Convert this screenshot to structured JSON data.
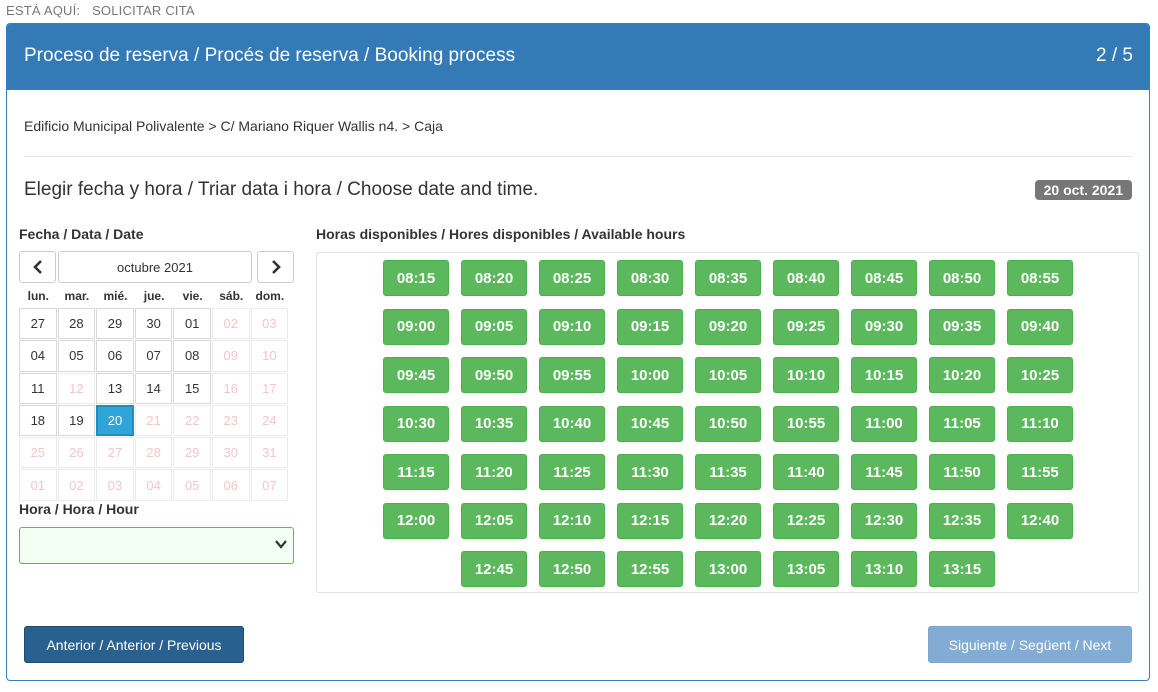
{
  "breadcrumb": {
    "label": "ESTÁ AQUÍ:",
    "current": "SOLICITAR CITA"
  },
  "panel": {
    "title": "Proceso de reserva / Procés de reserva / Booking process",
    "step": "2 / 5"
  },
  "location": "Edificio Municipal Polivalente > C/ Mariano Riquer Wallis n4. > Caja",
  "section_title": "Elegir fecha y hora / Triar data i hora / Choose date and time.",
  "selected_date_badge": "20 oct. 2021",
  "labels": {
    "date": "Fecha / Data / Date",
    "hours": "Horas disponibles / Hores disponibles / Available hours",
    "hour": "Hora / Hora / Hour"
  },
  "calendar": {
    "month": "octubre 2021",
    "prev_icon": "chevron-left-icon",
    "next_icon": "chevron-right-icon",
    "weekdays": [
      "lun.",
      "mar.",
      "mié.",
      "jue.",
      "vie.",
      "sáb.",
      "dom."
    ],
    "days": [
      {
        "d": "27",
        "s": "on"
      },
      {
        "d": "28",
        "s": "on"
      },
      {
        "d": "29",
        "s": "on"
      },
      {
        "d": "30",
        "s": "on"
      },
      {
        "d": "01",
        "s": "on"
      },
      {
        "d": "02",
        "s": "off"
      },
      {
        "d": "03",
        "s": "off"
      },
      {
        "d": "04",
        "s": "on"
      },
      {
        "d": "05",
        "s": "on"
      },
      {
        "d": "06",
        "s": "on"
      },
      {
        "d": "07",
        "s": "on"
      },
      {
        "d": "08",
        "s": "on"
      },
      {
        "d": "09",
        "s": "off"
      },
      {
        "d": "10",
        "s": "off"
      },
      {
        "d": "11",
        "s": "on"
      },
      {
        "d": "12",
        "s": "off"
      },
      {
        "d": "13",
        "s": "on"
      },
      {
        "d": "14",
        "s": "on"
      },
      {
        "d": "15",
        "s": "on"
      },
      {
        "d": "16",
        "s": "off"
      },
      {
        "d": "17",
        "s": "off"
      },
      {
        "d": "18",
        "s": "on"
      },
      {
        "d": "19",
        "s": "on"
      },
      {
        "d": "20",
        "s": "sel"
      },
      {
        "d": "21",
        "s": "off"
      },
      {
        "d": "22",
        "s": "off"
      },
      {
        "d": "23",
        "s": "off"
      },
      {
        "d": "24",
        "s": "off"
      },
      {
        "d": "25",
        "s": "off"
      },
      {
        "d": "26",
        "s": "off"
      },
      {
        "d": "27",
        "s": "off"
      },
      {
        "d": "28",
        "s": "off"
      },
      {
        "d": "29",
        "s": "off"
      },
      {
        "d": "30",
        "s": "off"
      },
      {
        "d": "31",
        "s": "off"
      },
      {
        "d": "01",
        "s": "off"
      },
      {
        "d": "02",
        "s": "off"
      },
      {
        "d": "03",
        "s": "off"
      },
      {
        "d": "04",
        "s": "off"
      },
      {
        "d": "05",
        "s": "off"
      },
      {
        "d": "06",
        "s": "off"
      },
      {
        "d": "07",
        "s": "off"
      }
    ]
  },
  "hour_select": {
    "value": "",
    "icon": "chevron-down-icon"
  },
  "available_hours": [
    "08:15",
    "08:20",
    "08:25",
    "08:30",
    "08:35",
    "08:40",
    "08:45",
    "08:50",
    "08:55",
    "09:00",
    "09:05",
    "09:10",
    "09:15",
    "09:20",
    "09:25",
    "09:30",
    "09:35",
    "09:40",
    "09:45",
    "09:50",
    "09:55",
    "10:00",
    "10:05",
    "10:10",
    "10:15",
    "10:20",
    "10:25",
    "10:30",
    "10:35",
    "10:40",
    "10:45",
    "10:50",
    "10:55",
    "11:00",
    "11:05",
    "11:10",
    "11:15",
    "11:20",
    "11:25",
    "11:30",
    "11:35",
    "11:40",
    "11:45",
    "11:50",
    "11:55",
    "12:00",
    "12:05",
    "12:10",
    "12:15",
    "12:20",
    "12:25",
    "12:30",
    "12:35",
    "12:40",
    "12:45",
    "12:50",
    "12:55",
    "13:00",
    "13:05",
    "13:10",
    "13:15"
  ],
  "buttons": {
    "previous": "Anterior / Anterior / Previous",
    "next": "Siguiente / Següent / Next"
  },
  "colors": {
    "primary": "#337ab7",
    "success": "#5cb85c",
    "selected_day": "#2fa4d9",
    "badge": "#777777",
    "disabled_next": "#83acd4"
  }
}
